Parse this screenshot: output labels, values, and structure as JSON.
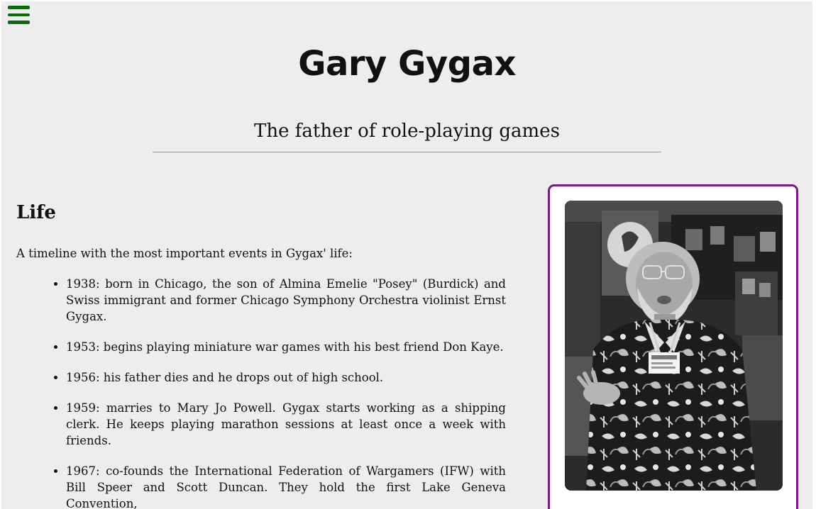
{
  "header": {
    "title": "Gary Gygax",
    "subtitle": "The father of role-playing games"
  },
  "menu": {
    "icon": "hamburger-menu-icon",
    "color": "#0b6a0b"
  },
  "life": {
    "heading": "Life",
    "intro": "A timeline with the most important events in Gygax' life:",
    "events": [
      "1938: born in Chicago, the son of Almina Emelie \"Posey\" (Burdick) and Swiss immigrant and former Chicago Symphony Orchestra violinist Ernst Gygax.",
      "1953: begins playing miniature war games with his best friend Don Kaye.",
      "1956: his father dies and he drops out of high school.",
      "1959: marries to Mary Jo Powell. Gygax starts working as a shipping clerk. He keeps playing marathon sessions at least once a week with friends.",
      "1967: co-founds the International Federation of Wargamers (IFW) with Bill Speer and Scott Duncan. They hold the first Lake Geneva Convention,"
    ]
  },
  "photo_card": {
    "border_color": "#7a1a84",
    "image": "portrait-photo"
  }
}
